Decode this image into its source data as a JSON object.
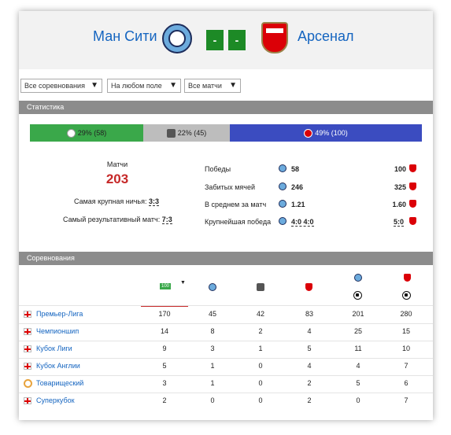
{
  "header": {
    "home_team": "Ман Сити",
    "away_team": "Арсенал",
    "score_home": "-",
    "score_away": "-"
  },
  "filters": {
    "competitions": "Все соревнования",
    "venue": "На любом поле",
    "matches": "Все матчи"
  },
  "stats": {
    "section_title": "Статистика",
    "home_pct": "29% (58)",
    "draw_pct": "22% (45)",
    "away_pct": "49% (100)",
    "home_share": 0.29,
    "draw_share": 0.22,
    "away_share": 0.49,
    "matches_label": "Матчи",
    "matches_total": "203",
    "biggest_draw_label": "Самая крупная ничья:",
    "biggest_draw": "3:3",
    "most_goals_label": "Самый результативный матч:",
    "most_goals": "7:3",
    "rows": [
      {
        "label": "Победы",
        "home": "58",
        "away": "100"
      },
      {
        "label": "Забитых мячей",
        "home": "246",
        "away": "325"
      },
      {
        "label": "В среднем за матч",
        "home": "1.21",
        "away": "1.60"
      },
      {
        "label": "Крупнейшая победа",
        "home": "4:0 4:0",
        "away": "5:0"
      }
    ]
  },
  "competitions": {
    "section_title": "Соревнования",
    "total_icon_text": "100",
    "rows": [
      {
        "name": "Премьер-Лига",
        "total": "170",
        "home_w": "45",
        "draws": "42",
        "away_w": "83",
        "home_goals": "201",
        "away_goals": "280"
      },
      {
        "name": "Чемпионшип",
        "total": "14",
        "home_w": "8",
        "draws": "2",
        "away_w": "4",
        "home_goals": "25",
        "away_goals": "15"
      },
      {
        "name": "Кубок Лиги",
        "total": "9",
        "home_w": "3",
        "draws": "1",
        "away_w": "5",
        "home_goals": "11",
        "away_goals": "10"
      },
      {
        "name": "Кубок Англии",
        "total": "5",
        "home_w": "1",
        "draws": "0",
        "away_w": "4",
        "home_goals": "4",
        "away_goals": "7"
      },
      {
        "name": "Товарищеский",
        "total": "3",
        "home_w": "1",
        "draws": "0",
        "away_w": "2",
        "home_goals": "5",
        "away_goals": "6"
      },
      {
        "name": "Суперкубок",
        "total": "2",
        "home_w": "0",
        "draws": "0",
        "away_w": "2",
        "home_goals": "0",
        "away_goals": "7"
      }
    ]
  },
  "colors": {
    "home": "#3aa84a",
    "draw": "#bdbdbd",
    "away": "#3b4cc0",
    "score_box": "#1d8a26"
  }
}
